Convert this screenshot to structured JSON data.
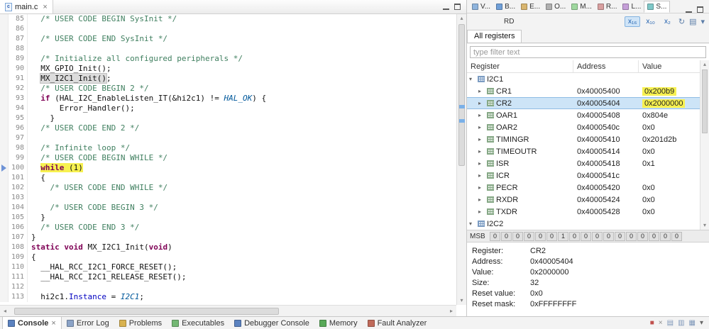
{
  "editor": {
    "tab": {
      "label": "main.c",
      "close": "×"
    },
    "code": {
      "lines": [
        {
          "n": 85,
          "s": [
            [
              "  ",
              "p"
            ],
            [
              "/* USER CODE BEGIN SysInit */",
              "c"
            ]
          ]
        },
        {
          "n": 86,
          "s": []
        },
        {
          "n": 87,
          "s": [
            [
              "  ",
              "p"
            ],
            [
              "/* USER CODE END SysInit */",
              "c"
            ]
          ]
        },
        {
          "n": 88,
          "s": []
        },
        {
          "n": 89,
          "s": [
            [
              "  ",
              "p"
            ],
            [
              "/* Initialize all configured peripherals */",
              "c"
            ]
          ]
        },
        {
          "n": 90,
          "s": [
            [
              "  MX_GPIO_Init();",
              "p"
            ]
          ]
        },
        {
          "n": 91,
          "s": [
            [
              "  ",
              "p"
            ],
            [
              "MX_I2C1_Init()",
              "occ"
            ],
            [
              ";",
              "p"
            ]
          ]
        },
        {
          "n": 92,
          "s": [
            [
              "  ",
              "p"
            ],
            [
              "/* USER CODE BEGIN 2 */",
              "c"
            ]
          ]
        },
        {
          "n": 93,
          "s": [
            [
              "  ",
              "p"
            ],
            [
              "if",
              "k"
            ],
            [
              " (HAL_I2C_EnableListen_IT(&hi2c1) != ",
              "p"
            ],
            [
              "HAL_OK",
              "m"
            ],
            [
              ") {",
              "p"
            ]
          ]
        },
        {
          "n": 94,
          "s": [
            [
              "      Error_Handler();",
              "p"
            ]
          ]
        },
        {
          "n": 95,
          "s": [
            [
              "    }",
              "p"
            ]
          ]
        },
        {
          "n": 96,
          "s": [
            [
              "  ",
              "p"
            ],
            [
              "/* USER CODE END 2 */",
              "c"
            ]
          ]
        },
        {
          "n": 97,
          "s": []
        },
        {
          "n": 98,
          "s": [
            [
              "  ",
              "p"
            ],
            [
              "/* Infinite loop */",
              "c"
            ]
          ]
        },
        {
          "n": 99,
          "s": [
            [
              "  ",
              "p"
            ],
            [
              "/* USER CODE BEGIN WHILE */",
              "c"
            ]
          ]
        },
        {
          "n": 100,
          "s": [
            [
              "  ",
              "p"
            ],
            [
              "while",
              "k hl"
            ],
            [
              " (1)",
              "p hl"
            ]
          ],
          "marker": "instruction-pointer"
        },
        {
          "n": 101,
          "s": [
            [
              "  {",
              "p"
            ]
          ]
        },
        {
          "n": 102,
          "s": [
            [
              "    ",
              "p"
            ],
            [
              "/* USER CODE END WHILE */",
              "c"
            ]
          ]
        },
        {
          "n": 103,
          "s": []
        },
        {
          "n": 104,
          "s": [
            [
              "    ",
              "p"
            ],
            [
              "/* USER CODE BEGIN 3 */",
              "c"
            ]
          ]
        },
        {
          "n": 105,
          "s": [
            [
              "  }",
              "p"
            ]
          ]
        },
        {
          "n": 106,
          "s": [
            [
              "  ",
              "p"
            ],
            [
              "/* USER CODE END 3 */",
              "c"
            ]
          ]
        },
        {
          "n": 107,
          "s": [
            [
              "}",
              "p"
            ]
          ]
        },
        {
          "n": 108,
          "s": [
            [
              "static",
              "k"
            ],
            [
              " ",
              "p"
            ],
            [
              "void",
              "k"
            ],
            [
              " MX_I2C1_Init(",
              "p"
            ],
            [
              "void",
              "k"
            ],
            [
              ")",
              "p"
            ]
          ]
        },
        {
          "n": 109,
          "s": [
            [
              "{",
              "p"
            ]
          ]
        },
        {
          "n": 110,
          "s": [
            [
              "  __HAL_RCC_I2C1_FORCE_RESET();",
              "p"
            ]
          ]
        },
        {
          "n": 111,
          "s": [
            [
              "  __HAL_RCC_I2C1_RELEASE_RESET();",
              "p"
            ]
          ]
        },
        {
          "n": 112,
          "s": []
        },
        {
          "n": 113,
          "s": [
            [
              "  hi2c1.",
              "p"
            ],
            [
              "Instance",
              "f"
            ],
            [
              " = ",
              "p"
            ],
            [
              "I2C1",
              "m"
            ],
            [
              ";",
              "p"
            ]
          ]
        }
      ]
    }
  },
  "right_panel": {
    "mini_tabs": [
      {
        "id": "variables",
        "label": "V...",
        "icon": "variables-icon",
        "color": "#8fb4dd"
      },
      {
        "id": "breakpoints",
        "label": "B...",
        "icon": "breakpoints-icon",
        "color": "#6f9fd8"
      },
      {
        "id": "expressions",
        "label": "E...",
        "icon": "expressions-icon",
        "color": "#d8b56f"
      },
      {
        "id": "outline",
        "label": "O...",
        "icon": "outline-icon",
        "color": "#b0b0b0"
      },
      {
        "id": "modules",
        "label": "M...",
        "icon": "modules-icon",
        "color": "#9fd89f"
      },
      {
        "id": "registers",
        "label": "R...",
        "icon": "registers-icon",
        "color": "#d89f9f"
      },
      {
        "id": "live-expressions",
        "label": "L...",
        "icon": "live-expressions-icon",
        "color": "#c59fd8"
      },
      {
        "id": "sfrs",
        "label": "S...",
        "icon": "sfrs-icon",
        "color": "#7fc8c8",
        "active": true
      }
    ],
    "toolbar": {
      "rd": "RD",
      "buttons": [
        {
          "name": "radix-hex-button",
          "label": "x₁₆",
          "kind": "radix",
          "active": true
        },
        {
          "name": "radix-dec-button",
          "label": "x₁₀",
          "kind": "radix"
        },
        {
          "name": "radix-bin-button",
          "label": "x₂",
          "kind": "radix"
        },
        {
          "name": "refresh-icon",
          "label": "↻",
          "kind": "glyph"
        },
        {
          "name": "export-icon",
          "label": "▤",
          "kind": "glyph"
        },
        {
          "name": "view-menu-icon",
          "label": "▾",
          "kind": "glyph"
        }
      ]
    },
    "registers_tab": "All registers",
    "filter_placeholder": "type filter text",
    "table": {
      "columns": [
        "Register",
        "Address",
        "Value"
      ],
      "rows": [
        {
          "type": "group",
          "name": "I2C1",
          "expanded": true
        },
        {
          "type": "reg",
          "name": "CR1",
          "address": "0x40005400",
          "value": "0x200b9",
          "value_hl": true
        },
        {
          "type": "reg",
          "name": "CR2",
          "address": "0x40005404",
          "value": "0x2000000",
          "value_hl": true,
          "selected": true
        },
        {
          "type": "reg",
          "name": "OAR1",
          "address": "0x40005408",
          "value": "0x804e"
        },
        {
          "type": "reg",
          "name": "OAR2",
          "address": "0x4000540c",
          "value": "0x0"
        },
        {
          "type": "reg",
          "name": "TIMINGR",
          "address": "0x40005410",
          "value": "0x201d2b"
        },
        {
          "type": "reg",
          "name": "TIMEOUTR",
          "address": "0x40005414",
          "value": "0x0"
        },
        {
          "type": "reg",
          "name": "ISR",
          "address": "0x40005418",
          "value": "0x1"
        },
        {
          "type": "reg",
          "name": "ICR",
          "address": "0x4000541c",
          "value": ""
        },
        {
          "type": "reg",
          "name": "PECR",
          "address": "0x40005420",
          "value": "0x0"
        },
        {
          "type": "reg",
          "name": "RXDR",
          "address": "0x40005424",
          "value": "0x0"
        },
        {
          "type": "reg",
          "name": "TXDR",
          "address": "0x40005428",
          "value": "0x0"
        },
        {
          "type": "group",
          "name": "I2C2",
          "expanded": true
        }
      ]
    },
    "bit_row": {
      "label": "MSB",
      "bits": [
        0,
        0,
        0,
        0,
        0,
        0,
        1,
        0,
        0,
        0,
        0,
        0,
        0,
        0,
        0,
        0,
        0
      ]
    },
    "details": [
      {
        "label": "Register:",
        "value": "CR2"
      },
      {
        "label": "Address:",
        "value": "0x40005404"
      },
      {
        "label": "Value:",
        "value": "0x2000000"
      },
      {
        "label": "Size:",
        "value": "32"
      },
      {
        "label": "Reset value:",
        "value": "0x0"
      },
      {
        "label": "Reset mask:",
        "value": "0xFFFFFFFF"
      }
    ]
  },
  "bottom_tabs": [
    {
      "label": "Console",
      "icon": "console-icon",
      "color": "#5b82c0",
      "close": "×",
      "active": true
    },
    {
      "label": "Error Log",
      "icon": "error-log-icon",
      "color": "#8ba3c7"
    },
    {
      "label": "Problems",
      "icon": "problems-icon",
      "color": "#d8b24f"
    },
    {
      "label": "Executables",
      "icon": "executables-icon",
      "color": "#74b874"
    },
    {
      "label": "Debugger Console",
      "icon": "debugger-console-icon",
      "color": "#5b82c0"
    },
    {
      "label": "Memory",
      "icon": "memory-icon",
      "color": "#57a857"
    },
    {
      "label": "Fault Analyzer",
      "icon": "fault-analyzer-icon",
      "color": "#c06a5a"
    }
  ],
  "bottom_right_icons": [
    {
      "name": "terminate-icon",
      "glyph": "■",
      "color": "#c0504d"
    },
    {
      "name": "remove-launch-icon",
      "glyph": "×",
      "color": "#8a8a8a"
    },
    {
      "name": "clear-console-icon",
      "glyph": "▤",
      "color": "#7d96b8"
    },
    {
      "name": "scroll-lock-icon",
      "glyph": "▥",
      "color": "#7d96b8"
    },
    {
      "name": "pin-console-icon",
      "glyph": "▦",
      "color": "#7d96b8"
    },
    {
      "name": "console-menu-icon",
      "glyph": "▾",
      "color": "#666666"
    }
  ]
}
